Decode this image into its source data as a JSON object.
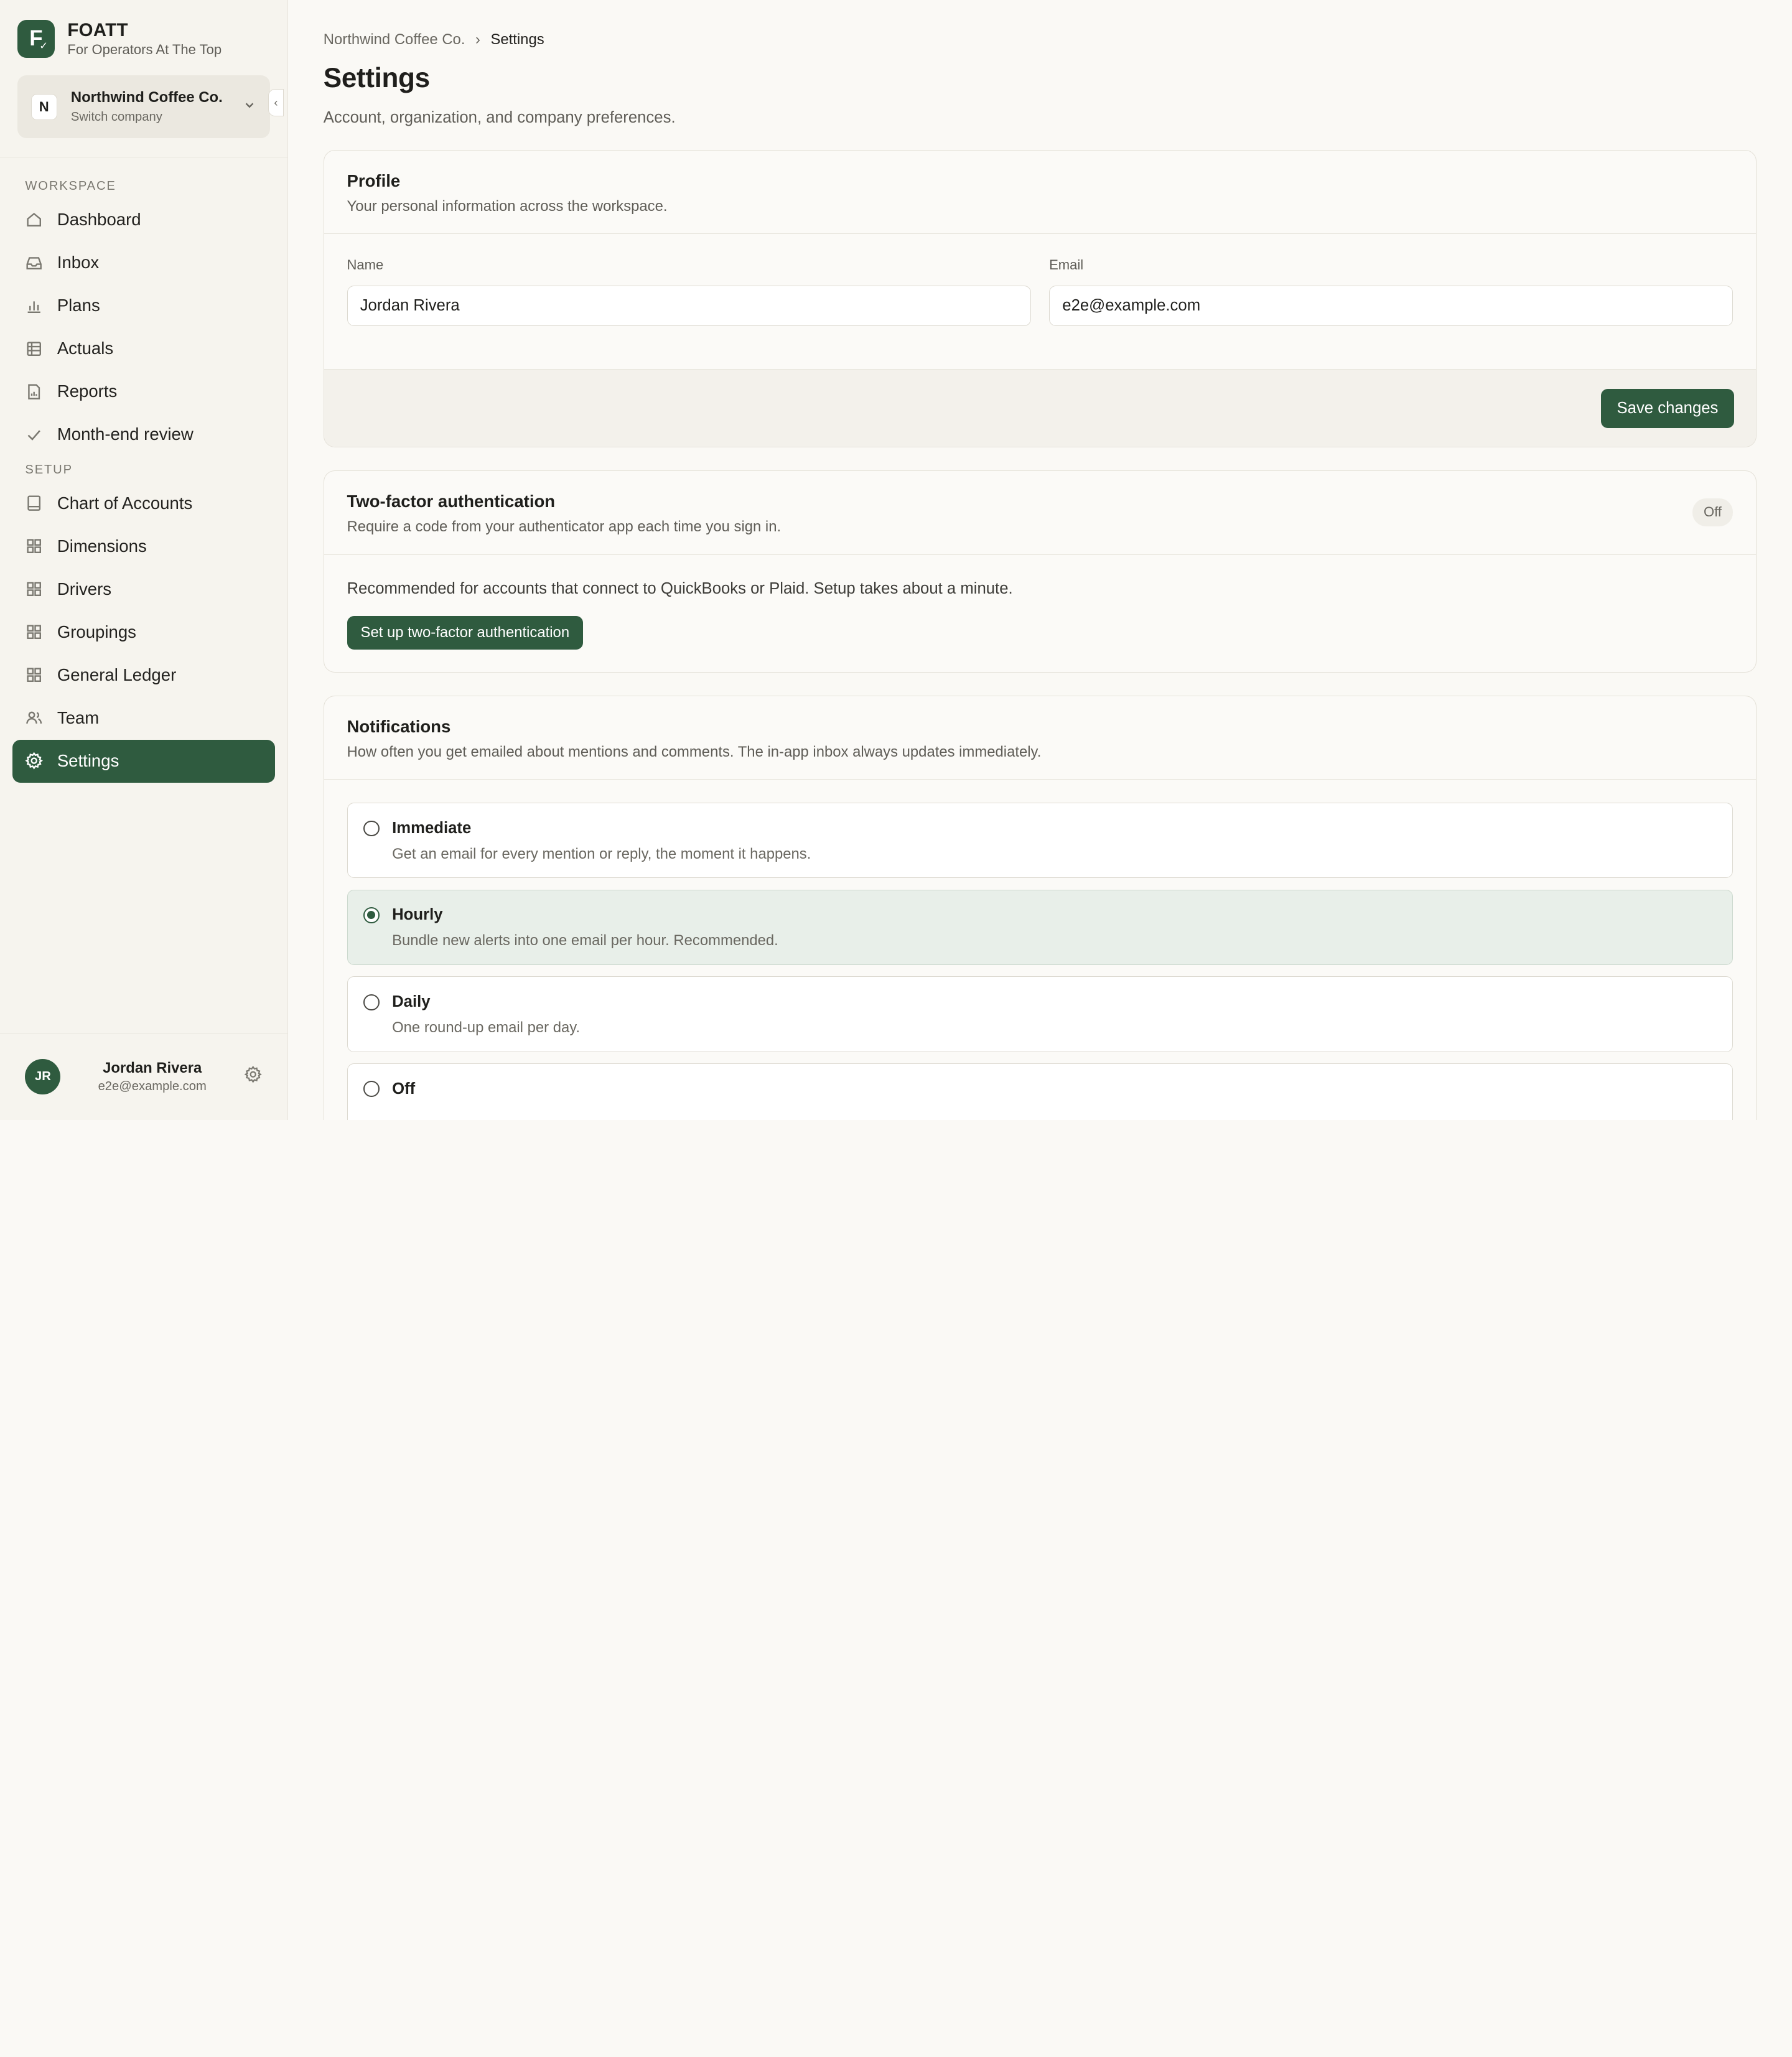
{
  "brand": {
    "title": "FOATT",
    "subtitle": "For Operators At The Top",
    "logo_letter": "F",
    "logo_mark": "✓"
  },
  "company": {
    "badge": "N",
    "name": "Northwind Coffee Co.",
    "sub": "Switch company"
  },
  "nav": {
    "workspace_label": "WORKSPACE",
    "setup_label": "SETUP",
    "workspace": [
      {
        "label": "Dashboard",
        "icon": "home-icon"
      },
      {
        "label": "Inbox",
        "icon": "inbox-icon"
      },
      {
        "label": "Plans",
        "icon": "bar-chart-icon"
      },
      {
        "label": "Actuals",
        "icon": "table-icon"
      },
      {
        "label": "Reports",
        "icon": "report-icon"
      },
      {
        "label": "Month-end review",
        "icon": "check-icon"
      }
    ],
    "setup": [
      {
        "label": "Chart of Accounts",
        "icon": "book-icon"
      },
      {
        "label": "Dimensions",
        "icon": "grid-icon"
      },
      {
        "label": "Drivers",
        "icon": "grid-icon"
      },
      {
        "label": "Groupings",
        "icon": "grid-icon"
      },
      {
        "label": "General Ledger",
        "icon": "grid-icon"
      },
      {
        "label": "Team",
        "icon": "users-icon"
      },
      {
        "label": "Settings",
        "icon": "gear-icon"
      }
    ]
  },
  "user": {
    "initials": "JR",
    "name": "Jordan Rivera",
    "email": "e2e@example.com"
  },
  "breadcrumb": {
    "parent": "Northwind Coffee Co.",
    "separator": "›",
    "current": "Settings"
  },
  "page": {
    "title": "Settings",
    "subtitle": "Account, organization, and company preferences."
  },
  "profile": {
    "title": "Profile",
    "desc": "Your personal information across the workspace.",
    "name_label": "Name",
    "name_value": "Jordan Rivera",
    "email_label": "Email",
    "email_value": "e2e@example.com",
    "save_label": "Save changes"
  },
  "tfa": {
    "title": "Two-factor authentication",
    "desc": "Require a code from your authenticator app each time you sign in.",
    "status": "Off",
    "body": "Recommended for accounts that connect to QuickBooks or Plaid. Setup takes about a minute.",
    "button": "Set up two-factor authentication"
  },
  "notifications": {
    "title": "Notifications",
    "desc": "How often you get emailed about mentions and comments. The in-app inbox always updates immediately.",
    "selected": "Hourly",
    "options": [
      {
        "title": "Immediate",
        "desc": "Get an email for every mention or reply, the moment it happens."
      },
      {
        "title": "Hourly",
        "desc": "Bundle new alerts into one email per hour. Recommended."
      },
      {
        "title": "Daily",
        "desc": "One round-up email per day."
      },
      {
        "title": "Off",
        "desc": ""
      }
    ]
  },
  "colors": {
    "accent": "#2f5b3f",
    "selected_bg": "#e8efe9"
  }
}
